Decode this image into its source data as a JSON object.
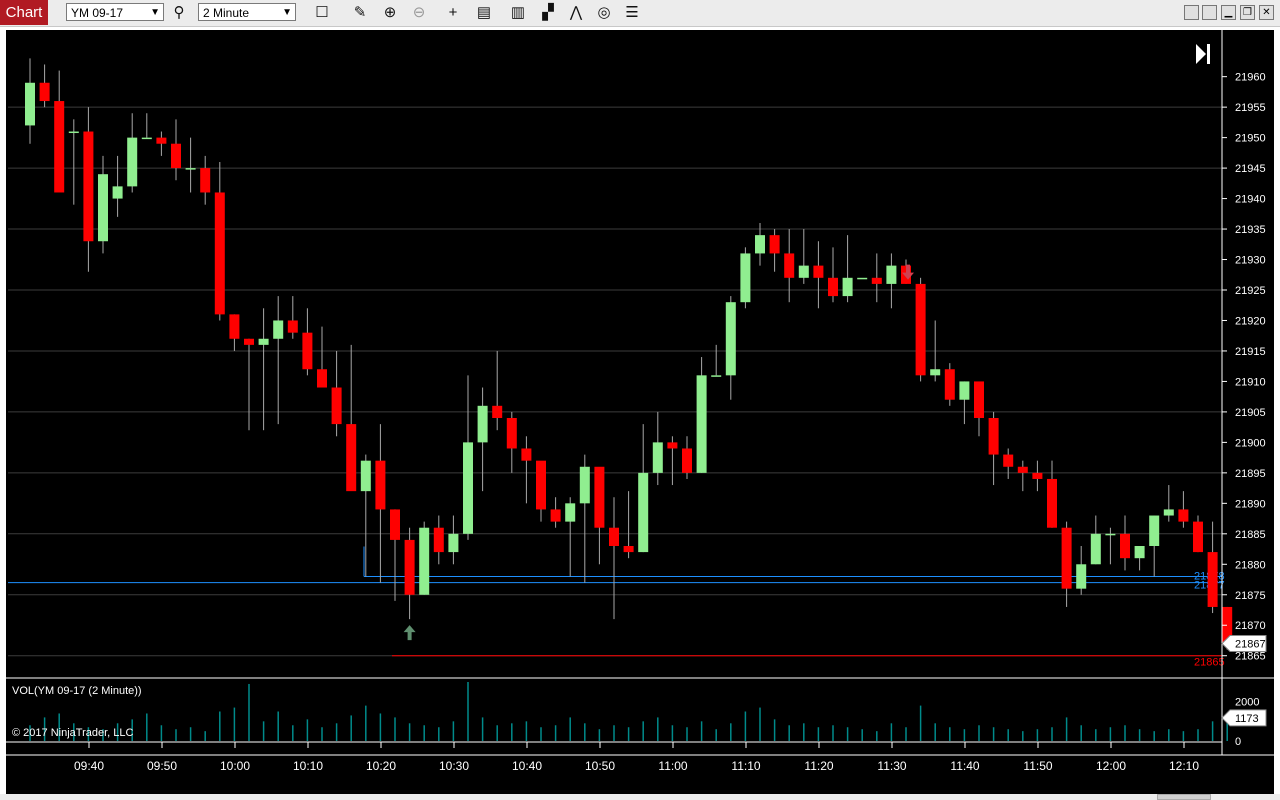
{
  "toolbar": {
    "tab_label": "Chart",
    "instrument": "YM 09-17",
    "interval": "2 Minute",
    "icons": [
      "search-icon",
      "box-select-icon",
      "pencil-icon",
      "zoom-in-icon",
      "zoom-out-icon",
      "crosshair-icon",
      "data-box-icon",
      "bar-type-icon",
      "chart-style-icon",
      "drawing-tools-icon",
      "indicator-icon",
      "properties-icon"
    ],
    "window_buttons": [
      "minimize",
      "restore",
      "close"
    ]
  },
  "volume_panel": {
    "label": "VOL(YM 09-17 (2 Minute))",
    "copyright": "© 2017 NinjaTrader, LLC",
    "axis_labels": [
      "2000",
      "0"
    ],
    "current_volume": "1173",
    "colors": {
      "bars": "#008b8b"
    }
  },
  "chart_data": {
    "type": "candlestick",
    "instrument": "YM 09-17",
    "interval": "2 Minute",
    "ylim": [
      21862,
      21967
    ],
    "yticks": [
      "21960",
      "21955",
      "21950",
      "21945",
      "21940",
      "21935",
      "21930",
      "21925",
      "21920",
      "21915",
      "21910",
      "21905",
      "21900",
      "21895",
      "21890",
      "21885",
      "21880",
      "21875",
      "21870",
      "21865"
    ],
    "xtick_labels": [
      "09:40",
      "09:50",
      "10:00",
      "10:10",
      "10:20",
      "10:30",
      "10:40",
      "10:50",
      "11:00",
      "11:10",
      "11:20",
      "11:30",
      "11:40",
      "11:50",
      "12:00",
      "12:10"
    ],
    "price_labels": {
      "last": "21867",
      "blue_line_1": "21878",
      "blue_line_2": "21877",
      "red_line": "21865"
    },
    "colors": {
      "up": "#90ee90",
      "down": "#ff0000",
      "wick": "#a9a9a9",
      "blue_line": "#1e90ff",
      "red_line": "#ff0000",
      "grid": "#3c3c3c"
    },
    "candles": [
      [
        21952,
        21963,
        21949,
        21959
      ],
      [
        21959,
        21962,
        21955,
        21956
      ],
      [
        21956,
        21961,
        21944,
        21941
      ],
      [
        21951,
        21953,
        21939,
        21951
      ],
      [
        21951,
        21955,
        21928,
        21933
      ],
      [
        21933,
        21947,
        21931,
        21944
      ],
      [
        21940,
        21947,
        21937,
        21942
      ],
      [
        21942,
        21954,
        21941,
        21950
      ],
      [
        21950,
        21954,
        21950,
        21950
      ],
      [
        21950,
        21951,
        21947,
        21949
      ],
      [
        21949,
        21953,
        21943,
        21945
      ],
      [
        21945,
        21950,
        21941,
        21945
      ],
      [
        21945,
        21947,
        21939,
        21941
      ],
      [
        21941,
        21946,
        21920,
        21921
      ],
      [
        21921,
        21921,
        21915,
        21917
      ],
      [
        21917,
        21917,
        21902,
        21916
      ],
      [
        21916,
        21922,
        21902,
        21917
      ],
      [
        21917,
        21924,
        21903,
        21920
      ],
      [
        21920,
        21924,
        21917,
        21918
      ],
      [
        21918,
        21922,
        21911,
        21912
      ],
      [
        21912,
        21919,
        21909,
        21909
      ],
      [
        21909,
        21915,
        21901,
        21903
      ],
      [
        21903,
        21916,
        21894,
        21892
      ],
      [
        21892,
        21898,
        21878,
        21897
      ],
      [
        21897,
        21903,
        21877,
        21889
      ],
      [
        21889,
        21889,
        21874,
        21884
      ],
      [
        21884,
        21886,
        21871,
        21875
      ],
      [
        21875,
        21887,
        21875,
        21886
      ],
      [
        21886,
        21888,
        21880,
        21882
      ],
      [
        21882,
        21888,
        21880,
        21885
      ],
      [
        21885,
        21911,
        21884,
        21900
      ],
      [
        21900,
        21909,
        21892,
        21906
      ],
      [
        21906,
        21915,
        21902,
        21904
      ],
      [
        21904,
        21905,
        21895,
        21899
      ],
      [
        21899,
        21901,
        21890,
        21897
      ],
      [
        21897,
        21896,
        21887,
        21889
      ],
      [
        21889,
        21891,
        21886,
        21887
      ],
      [
        21887,
        21891,
        21878,
        21890
      ],
      [
        21890,
        21898,
        21877,
        21896
      ],
      [
        21896,
        21894,
        21880,
        21886
      ],
      [
        21886,
        21891,
        21871,
        21883
      ],
      [
        21883,
        21892,
        21881,
        21882
      ],
      [
        21882,
        21903,
        21882,
        21895
      ],
      [
        21895,
        21905,
        21893,
        21900
      ],
      [
        21900,
        21901,
        21893,
        21899
      ],
      [
        21899,
        21901,
        21894,
        21895
      ],
      [
        21895,
        21914,
        21895,
        21911
      ],
      [
        21911,
        21916,
        21911,
        21911
      ],
      [
        21911,
        21924,
        21907,
        21923
      ],
      [
        21923,
        21932,
        21922,
        21931
      ],
      [
        21931,
        21936,
        21929,
        21934
      ],
      [
        21934,
        21935,
        21928,
        21931
      ],
      [
        21931,
        21935,
        21923,
        21927
      ],
      [
        21927,
        21935,
        21926,
        21929
      ],
      [
        21929,
        21933,
        21922,
        21927
      ],
      [
        21927,
        21932,
        21923,
        21924
      ],
      [
        21924,
        21934,
        21923,
        21927
      ],
      [
        21927,
        21927,
        21927,
        21927
      ],
      [
        21927,
        21931,
        21923,
        21926
      ],
      [
        21926,
        21931,
        21922,
        21929
      ],
      [
        21929,
        21930,
        21926,
        21926
      ],
      [
        21926,
        21927,
        21910,
        21911
      ],
      [
        21911,
        21920,
        21910,
        21912
      ],
      [
        21912,
        21913,
        21906,
        21907
      ],
      [
        21907,
        21910,
        21903,
        21910
      ],
      [
        21910,
        21907,
        21901,
        21904
      ],
      [
        21904,
        21905,
        21893,
        21898
      ],
      [
        21898,
        21899,
        21894,
        21896
      ],
      [
        21896,
        21897,
        21892,
        21895
      ],
      [
        21895,
        21897,
        21892,
        21894
      ],
      [
        21894,
        21897,
        21886,
        21886
      ],
      [
        21886,
        21887,
        21873,
        21876
      ],
      [
        21876,
        21883,
        21875,
        21880
      ],
      [
        21880,
        21888,
        21880,
        21885
      ],
      [
        21885,
        21886,
        21880,
        21885
      ],
      [
        21885,
        21888,
        21879,
        21881
      ],
      [
        21881,
        21883,
        21879,
        21883
      ],
      [
        21883,
        21888,
        21878,
        21888
      ],
      [
        21888,
        21893,
        21887,
        21889
      ],
      [
        21889,
        21892,
        21886,
        21887
      ],
      [
        21887,
        21888,
        21882,
        21882
      ],
      [
        21882,
        21887,
        21872,
        21873
      ],
      [
        21873,
        21873,
        21866,
        21867
      ]
    ],
    "volume": {
      "ylim": [
        0,
        3000
      ],
      "values": [
        800,
        1200,
        1400,
        900,
        700,
        600,
        900,
        1100,
        1400,
        800,
        600,
        700,
        500,
        1500,
        1700,
        2900,
        1000,
        1500,
        800,
        1100,
        700,
        900,
        1300,
        1800,
        1400,
        1200,
        900,
        800,
        700,
        1000,
        3000,
        1200,
        800,
        900,
        1000,
        700,
        800,
        1200,
        900,
        600,
        800,
        700,
        1000,
        1200,
        800,
        700,
        1000,
        600,
        900,
        1500,
        1700,
        1100,
        800,
        900,
        700,
        800,
        700,
        600,
        500,
        900,
        700,
        1800,
        900,
        700,
        600,
        800,
        700,
        600,
        500,
        600,
        700,
        1200,
        800,
        600,
        700,
        800,
        600,
        500,
        600,
        500,
        600,
        1000,
        1173
      ]
    }
  }
}
